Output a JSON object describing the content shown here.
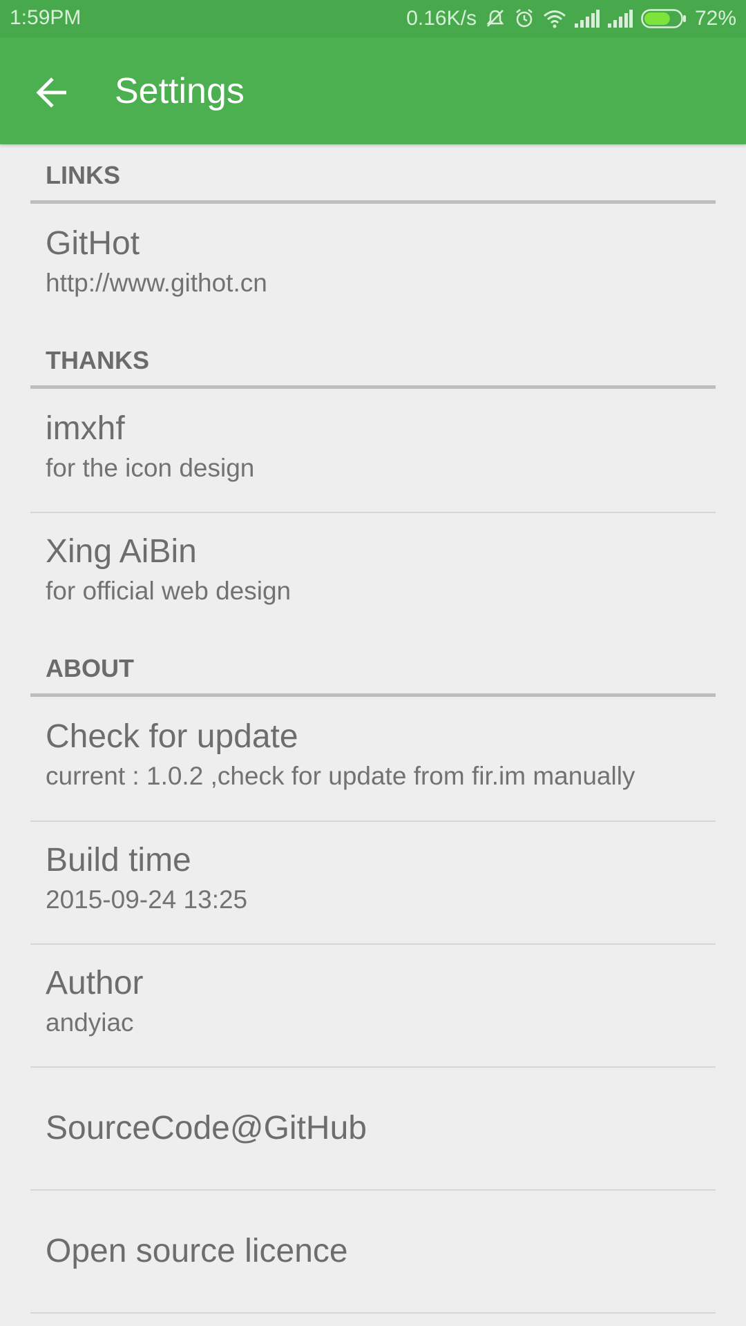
{
  "status_bar": {
    "time": "1:59PM",
    "net_speed": "0.16K/s",
    "battery_percent": "72%",
    "battery_level": 0.72,
    "icons": [
      "mute-icon",
      "alarm-icon",
      "wifi-icon",
      "signal-icon",
      "signal-icon",
      "battery-icon"
    ]
  },
  "app_bar": {
    "title": "Settings",
    "back_icon": "arrow-back-icon",
    "color": "#4caf50"
  },
  "sections": {
    "links": {
      "header": "LINKS",
      "items": [
        {
          "title": "GitHot",
          "summary": "http://www.githot.cn"
        }
      ]
    },
    "thanks": {
      "header": "THANKS",
      "items": [
        {
          "title": "imxhf",
          "summary": "for the icon design"
        },
        {
          "title": "Xing AiBin",
          "summary": "for official web design"
        }
      ]
    },
    "about": {
      "header": "ABOUT",
      "items": [
        {
          "title": "Check for update",
          "summary": "current : 1.0.2 ,check for update from fir.im manually"
        },
        {
          "title": "Build time",
          "summary": "2015-09-24 13:25"
        },
        {
          "title": "Author",
          "summary": "andyiac"
        },
        {
          "title": "SourceCode@GitHub"
        },
        {
          "title": "Open source licence"
        }
      ]
    }
  }
}
